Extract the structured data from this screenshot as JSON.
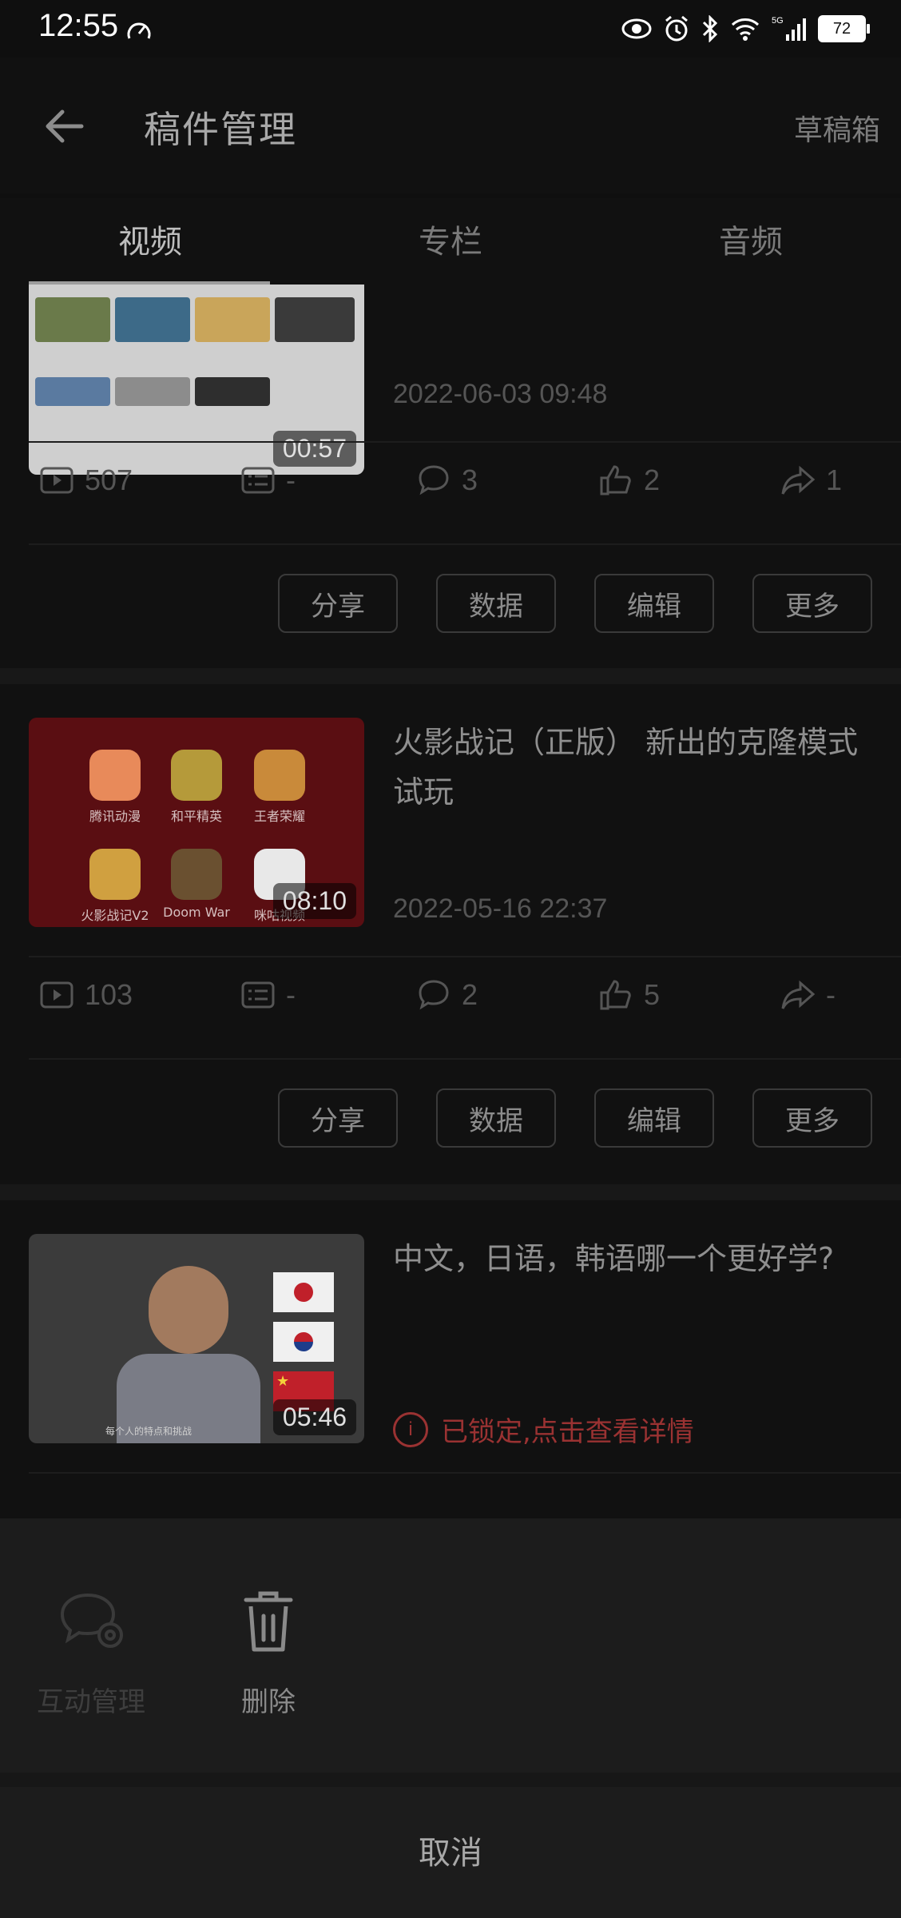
{
  "status": {
    "time": "12:55",
    "battery": "72",
    "icons": [
      "speed-icon",
      "eye-icon",
      "alarm-icon",
      "bluetooth-icon",
      "wifi-icon",
      "5g-signal-icon"
    ]
  },
  "appbar": {
    "title": "稿件管理",
    "drafts": "草稿箱"
  },
  "tabs": [
    {
      "label": "视频",
      "active": true
    },
    {
      "label": "专栏",
      "active": false
    },
    {
      "label": "音频",
      "active": false
    }
  ],
  "videos": [
    {
      "title": "",
      "duration": "00:57",
      "date": "2022-06-03 09:48",
      "stats": {
        "plays": "507",
        "danmaku": "-",
        "comments": "3",
        "likes": "2",
        "shares": "1"
      }
    },
    {
      "title": "火影战记（正版） 新出的克隆模式 试玩",
      "duration": "08:10",
      "date": "2022-05-16 22:37",
      "stats": {
        "plays": "103",
        "danmaku": "-",
        "comments": "2",
        "likes": "5",
        "shares": "-"
      }
    },
    {
      "title": "中文，日语，韩语哪一个更好学?",
      "duration": "05:46",
      "locked_text": "已锁定,点击查看详情",
      "thumb_caption": "每个人的特点和挑战"
    }
  ],
  "thumb2_apps": [
    "腾讯动漫",
    "和平精英",
    "王者荣耀",
    "火影战记V2",
    "Doom War",
    "咪咕视频"
  ],
  "actions": {
    "share": "分享",
    "data": "数据",
    "edit": "编辑",
    "more": "更多"
  },
  "sheet": {
    "interaction": "互动管理",
    "delete": "删除",
    "cancel": "取消"
  },
  "colors": {
    "background": "#0f0f0f",
    "sheet": "#1c1c1c",
    "locked": "#9a3232"
  }
}
